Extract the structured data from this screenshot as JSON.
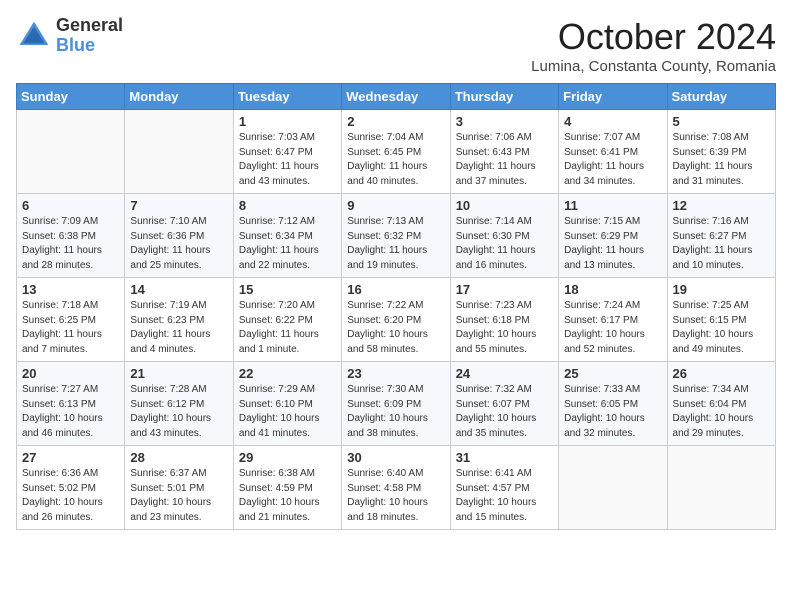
{
  "header": {
    "logo_general": "General",
    "logo_blue": "Blue",
    "month": "October 2024",
    "location": "Lumina, Constanta County, Romania"
  },
  "weekdays": [
    "Sunday",
    "Monday",
    "Tuesday",
    "Wednesday",
    "Thursday",
    "Friday",
    "Saturday"
  ],
  "weeks": [
    [
      {
        "day": "",
        "info": ""
      },
      {
        "day": "",
        "info": ""
      },
      {
        "day": "1",
        "info": "Sunrise: 7:03 AM\nSunset: 6:47 PM\nDaylight: 11 hours and 43 minutes."
      },
      {
        "day": "2",
        "info": "Sunrise: 7:04 AM\nSunset: 6:45 PM\nDaylight: 11 hours and 40 minutes."
      },
      {
        "day": "3",
        "info": "Sunrise: 7:06 AM\nSunset: 6:43 PM\nDaylight: 11 hours and 37 minutes."
      },
      {
        "day": "4",
        "info": "Sunrise: 7:07 AM\nSunset: 6:41 PM\nDaylight: 11 hours and 34 minutes."
      },
      {
        "day": "5",
        "info": "Sunrise: 7:08 AM\nSunset: 6:39 PM\nDaylight: 11 hours and 31 minutes."
      }
    ],
    [
      {
        "day": "6",
        "info": "Sunrise: 7:09 AM\nSunset: 6:38 PM\nDaylight: 11 hours and 28 minutes."
      },
      {
        "day": "7",
        "info": "Sunrise: 7:10 AM\nSunset: 6:36 PM\nDaylight: 11 hours and 25 minutes."
      },
      {
        "day": "8",
        "info": "Sunrise: 7:12 AM\nSunset: 6:34 PM\nDaylight: 11 hours and 22 minutes."
      },
      {
        "day": "9",
        "info": "Sunrise: 7:13 AM\nSunset: 6:32 PM\nDaylight: 11 hours and 19 minutes."
      },
      {
        "day": "10",
        "info": "Sunrise: 7:14 AM\nSunset: 6:30 PM\nDaylight: 11 hours and 16 minutes."
      },
      {
        "day": "11",
        "info": "Sunrise: 7:15 AM\nSunset: 6:29 PM\nDaylight: 11 hours and 13 minutes."
      },
      {
        "day": "12",
        "info": "Sunrise: 7:16 AM\nSunset: 6:27 PM\nDaylight: 11 hours and 10 minutes."
      }
    ],
    [
      {
        "day": "13",
        "info": "Sunrise: 7:18 AM\nSunset: 6:25 PM\nDaylight: 11 hours and 7 minutes."
      },
      {
        "day": "14",
        "info": "Sunrise: 7:19 AM\nSunset: 6:23 PM\nDaylight: 11 hours and 4 minutes."
      },
      {
        "day": "15",
        "info": "Sunrise: 7:20 AM\nSunset: 6:22 PM\nDaylight: 11 hours and 1 minute."
      },
      {
        "day": "16",
        "info": "Sunrise: 7:22 AM\nSunset: 6:20 PM\nDaylight: 10 hours and 58 minutes."
      },
      {
        "day": "17",
        "info": "Sunrise: 7:23 AM\nSunset: 6:18 PM\nDaylight: 10 hours and 55 minutes."
      },
      {
        "day": "18",
        "info": "Sunrise: 7:24 AM\nSunset: 6:17 PM\nDaylight: 10 hours and 52 minutes."
      },
      {
        "day": "19",
        "info": "Sunrise: 7:25 AM\nSunset: 6:15 PM\nDaylight: 10 hours and 49 minutes."
      }
    ],
    [
      {
        "day": "20",
        "info": "Sunrise: 7:27 AM\nSunset: 6:13 PM\nDaylight: 10 hours and 46 minutes."
      },
      {
        "day": "21",
        "info": "Sunrise: 7:28 AM\nSunset: 6:12 PM\nDaylight: 10 hours and 43 minutes."
      },
      {
        "day": "22",
        "info": "Sunrise: 7:29 AM\nSunset: 6:10 PM\nDaylight: 10 hours and 41 minutes."
      },
      {
        "day": "23",
        "info": "Sunrise: 7:30 AM\nSunset: 6:09 PM\nDaylight: 10 hours and 38 minutes."
      },
      {
        "day": "24",
        "info": "Sunrise: 7:32 AM\nSunset: 6:07 PM\nDaylight: 10 hours and 35 minutes."
      },
      {
        "day": "25",
        "info": "Sunrise: 7:33 AM\nSunset: 6:05 PM\nDaylight: 10 hours and 32 minutes."
      },
      {
        "day": "26",
        "info": "Sunrise: 7:34 AM\nSunset: 6:04 PM\nDaylight: 10 hours and 29 minutes."
      }
    ],
    [
      {
        "day": "27",
        "info": "Sunrise: 6:36 AM\nSunset: 5:02 PM\nDaylight: 10 hours and 26 minutes."
      },
      {
        "day": "28",
        "info": "Sunrise: 6:37 AM\nSunset: 5:01 PM\nDaylight: 10 hours and 23 minutes."
      },
      {
        "day": "29",
        "info": "Sunrise: 6:38 AM\nSunset: 4:59 PM\nDaylight: 10 hours and 21 minutes."
      },
      {
        "day": "30",
        "info": "Sunrise: 6:40 AM\nSunset: 4:58 PM\nDaylight: 10 hours and 18 minutes."
      },
      {
        "day": "31",
        "info": "Sunrise: 6:41 AM\nSunset: 4:57 PM\nDaylight: 10 hours and 15 minutes."
      },
      {
        "day": "",
        "info": ""
      },
      {
        "day": "",
        "info": ""
      }
    ]
  ]
}
